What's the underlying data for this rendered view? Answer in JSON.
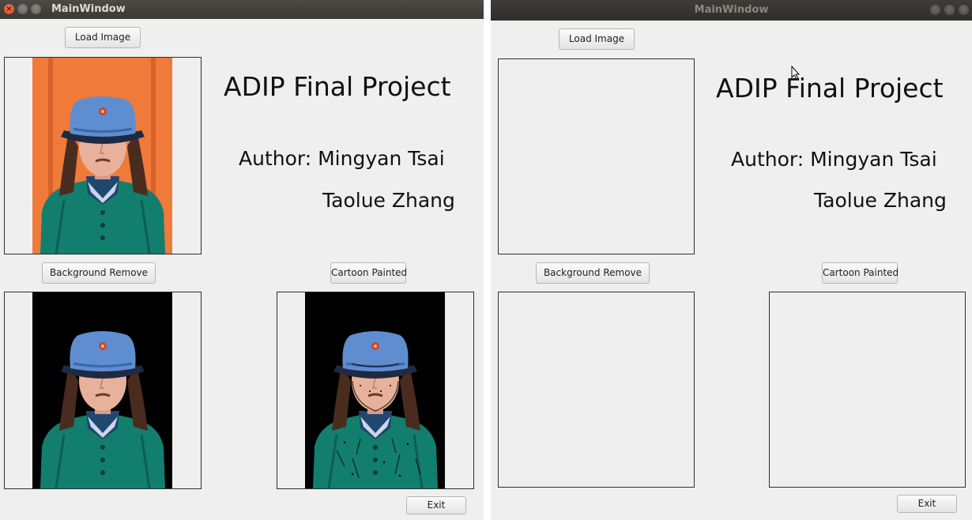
{
  "windows": [
    {
      "title": "MainWindow",
      "load_button": "Load Image",
      "heading": "ADIP Final Project",
      "author_line": "Author: Mingyan Tsai",
      "second_author": "Taolue Zhang",
      "bg_remove_button": "Background Remove",
      "cartoon_button": "Cartoon Painted",
      "exit_button": "Exit",
      "panels_loaded": true
    },
    {
      "title": "MainWindow",
      "load_button": "Load Image",
      "heading": "ADIP Final Project",
      "author_line": "Author: Mingyan Tsai",
      "second_author": "Taolue Zhang",
      "bg_remove_button": "Background Remove",
      "cartoon_button": "Cartoon Painted",
      "exit_button": "Exit",
      "panels_loaded": false
    }
  ],
  "icons": {
    "close": "close-icon",
    "minimize": "minimize-icon",
    "maximize": "maximize-icon",
    "cursor": "mouse-pointer-icon",
    "photo": "portrait-photo-icon"
  },
  "colors": {
    "window_bg": "#efefef",
    "titlebar": "#3f3e3a",
    "photo_orange": "#ef7a3a",
    "jacket_teal": "#127e6e",
    "hat_blue": "#5e8ed0"
  }
}
